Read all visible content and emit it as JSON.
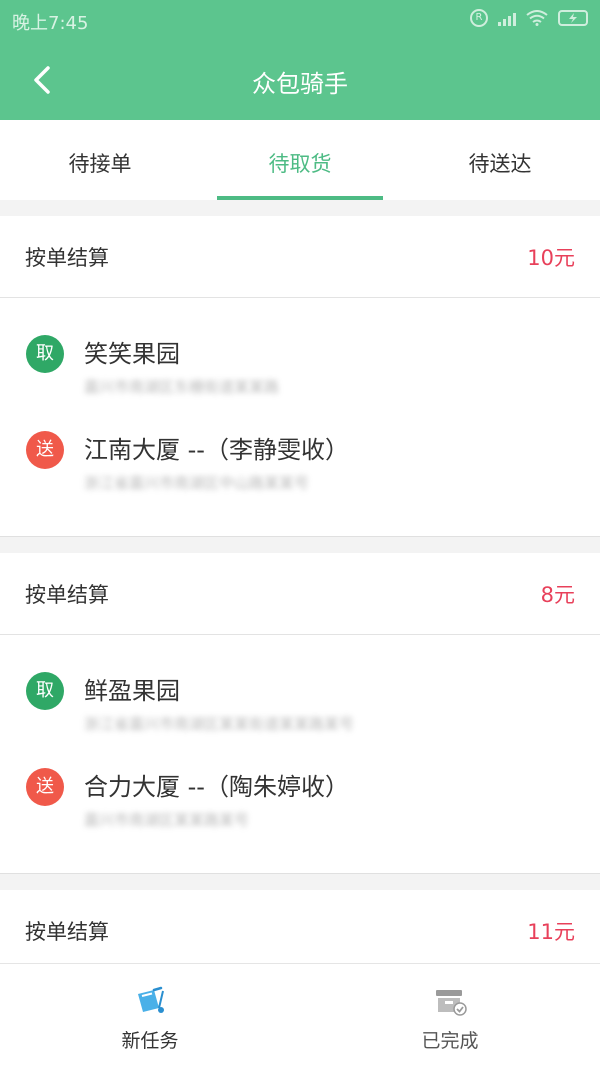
{
  "status_bar": {
    "time": "晚上7:45",
    "r_icon": "R"
  },
  "header": {
    "title": "众包骑手",
    "back_icon": "chevron-left-icon"
  },
  "tabs": [
    {
      "label": "待接单",
      "active": false
    },
    {
      "label": "待取货",
      "active": true
    },
    {
      "label": "待送达",
      "active": false
    }
  ],
  "orders": [
    {
      "settle_label": "按单结算",
      "price": "10元",
      "pickup": {
        "badge": "取",
        "name": "笑笑果园",
        "address": "嘉兴市南湖区东栅街道某某路"
      },
      "delivery": {
        "badge": "送",
        "name": "江南大厦 --（李静雯收）",
        "address": "浙江省嘉兴市南湖区中山路某某号"
      }
    },
    {
      "settle_label": "按单结算",
      "price": "8元",
      "pickup": {
        "badge": "取",
        "name": "鲜盈果园",
        "address": "浙江省嘉兴市南湖区某某街道某某路某号"
      },
      "delivery": {
        "badge": "送",
        "name": "合力大厦 --（陶朱婷收）",
        "address": "嘉兴市南湖区某某路某号"
      }
    },
    {
      "settle_label": "按单结算",
      "price": "11元"
    }
  ],
  "bottom_nav": [
    {
      "label": "新任务",
      "icon": "new-task-icon"
    },
    {
      "label": "已完成",
      "icon": "completed-icon"
    }
  ],
  "colors": {
    "primary": "#5cc58e",
    "accent": "#4dbb84",
    "price": "#e8405a",
    "pickup": "#2fa866",
    "delivery": "#f0594a"
  }
}
